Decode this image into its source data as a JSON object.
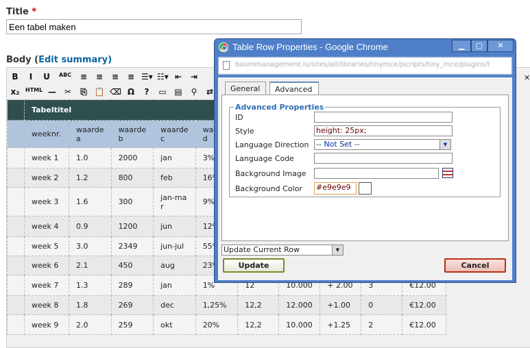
{
  "title_field": {
    "label": "Title",
    "required_mark": "*",
    "value": "Een tabel maken"
  },
  "body_field": {
    "label": "Body (",
    "link": "Edit summary",
    "close": ")"
  },
  "toolbar": {
    "row1": [
      "B",
      "I",
      "U",
      "ABC",
      "≡",
      "≡",
      "≡",
      "≡",
      "☰▾",
      "☷▾",
      "⇤",
      "⇥"
    ],
    "row2": [
      "x₂",
      "HTML",
      "—",
      "✂",
      "⎘",
      "📋",
      "⌫",
      "Ω",
      "?",
      "▭",
      "▤",
      "⚲",
      "⇄"
    ],
    "extra": [
      "▾",
      "✕"
    ]
  },
  "table": {
    "caption": "Tabeltitel",
    "headers": [
      "weeknr.",
      "waarde a",
      "waarde b",
      "waarde c",
      "waarde d",
      "",
      "",
      "",
      "",
      ""
    ],
    "rows": [
      [
        "week 1",
        "1.0",
        "2000",
        "jan",
        "3%",
        "",
        "",
        "",
        "",
        ""
      ],
      [
        "week 2",
        "1.2",
        "800",
        "feb",
        "16%",
        "",
        "",
        "",
        "",
        ""
      ],
      [
        "week 3",
        "1.6",
        "300",
        "jan-mar",
        "9%",
        "",
        "",
        "",
        "",
        ""
      ],
      [
        "week 4",
        "0.9",
        "1200",
        "jun",
        "12%",
        "",
        "",
        "",
        "",
        ""
      ],
      [
        "week 5",
        "3.0",
        "2349",
        "jun-jul",
        "55%",
        "",
        "",
        "",
        "",
        ""
      ],
      [
        "week 6",
        "2.1",
        "450",
        "aug",
        "23%",
        "",
        "",
        "",
        "",
        ""
      ],
      [
        "week 7",
        "1.3",
        "289",
        "jan",
        "1%",
        "12",
        "10.000",
        "+ 2.00",
        "3",
        "€12.00"
      ],
      [
        "week 8",
        "1.8",
        "269",
        "dec",
        "1,25%",
        "12,2",
        "12.000",
        "+1.00",
        "0",
        "€12.00"
      ],
      [
        "week 9",
        "2.0",
        "259",
        "okt",
        "20%",
        "12,2",
        "10.000",
        "+1.25",
        "2",
        "€12.00"
      ]
    ]
  },
  "dialog": {
    "title": "Table Row Properties - Google Chrome",
    "url": "baummanagement.lu/sites/all/libraries/tinymce/jscripts/tiny_mce/plugins/t",
    "tabs": [
      "General",
      "Advanced"
    ],
    "active_tab": "Advanced",
    "legend": "Advanced Properties",
    "fields": {
      "id_label": "ID",
      "id_value": "",
      "style_label": "Style",
      "style_value": "height: 25px;",
      "dir_label": "Language Direction",
      "dir_value": "-- Not Set --",
      "code_label": "Language Code",
      "code_value": "",
      "bgimg_label": "Background Image",
      "bgimg_value": "",
      "bgcolor_label": "Background Color",
      "bgcolor_value": "#e9e9e9"
    },
    "action_select": "Update Current Row",
    "update_label": "Update",
    "cancel_label": "Cancel"
  }
}
